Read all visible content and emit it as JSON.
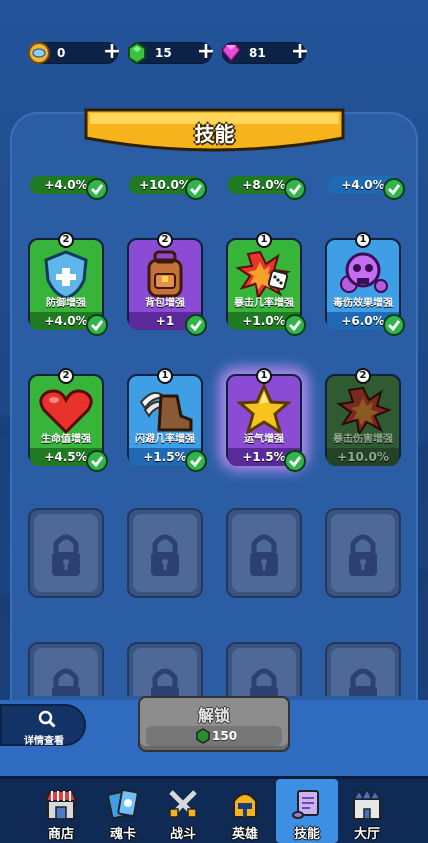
{
  "currencies": [
    {
      "name": "coin",
      "value": "0"
    },
    {
      "name": "gem",
      "value": "15"
    },
    {
      "name": "diamond",
      "value": "81"
    }
  ],
  "title": "技能",
  "top_row": [
    "+4.0%",
    "+10.0%",
    "+8.0%",
    "+4.0%"
  ],
  "skills": [
    {
      "name": "防御增强",
      "value": "+4.0%",
      "level": "2",
      "color": "green"
    },
    {
      "name": "背包增强",
      "value": "+1",
      "level": "2",
      "color": "purple"
    },
    {
      "name": "暴击几率增强",
      "value": "+1.0%",
      "level": "1",
      "color": "green"
    },
    {
      "name": "毒伤效果增强",
      "value": "+6.0%",
      "level": "1",
      "color": "blue"
    },
    {
      "name": "生命值增强",
      "value": "+4.5%",
      "level": "2",
      "color": "green"
    },
    {
      "name": "闪避几率增强",
      "value": "+1.5%",
      "level": "1",
      "color": "blue"
    },
    {
      "name": "运气增强",
      "value": "+1.5%",
      "level": "1",
      "color": "purple"
    },
    {
      "name": "暴击伤害增强",
      "value": "+10.0%",
      "level": "2",
      "color": "green"
    }
  ],
  "details_label": "详情查看",
  "unlock": {
    "label": "解锁",
    "cost": "150"
  },
  "nav": [
    {
      "label": "商店",
      "icon": "shop-icon"
    },
    {
      "label": "魂卡",
      "icon": "cards-icon"
    },
    {
      "label": "战斗",
      "icon": "crossed-swords-icon"
    },
    {
      "label": "英雄",
      "icon": "helmet-icon"
    },
    {
      "label": "技能",
      "icon": "scroll-icon",
      "active": true
    },
    {
      "label": "大厅",
      "icon": "castle-icon"
    }
  ]
}
